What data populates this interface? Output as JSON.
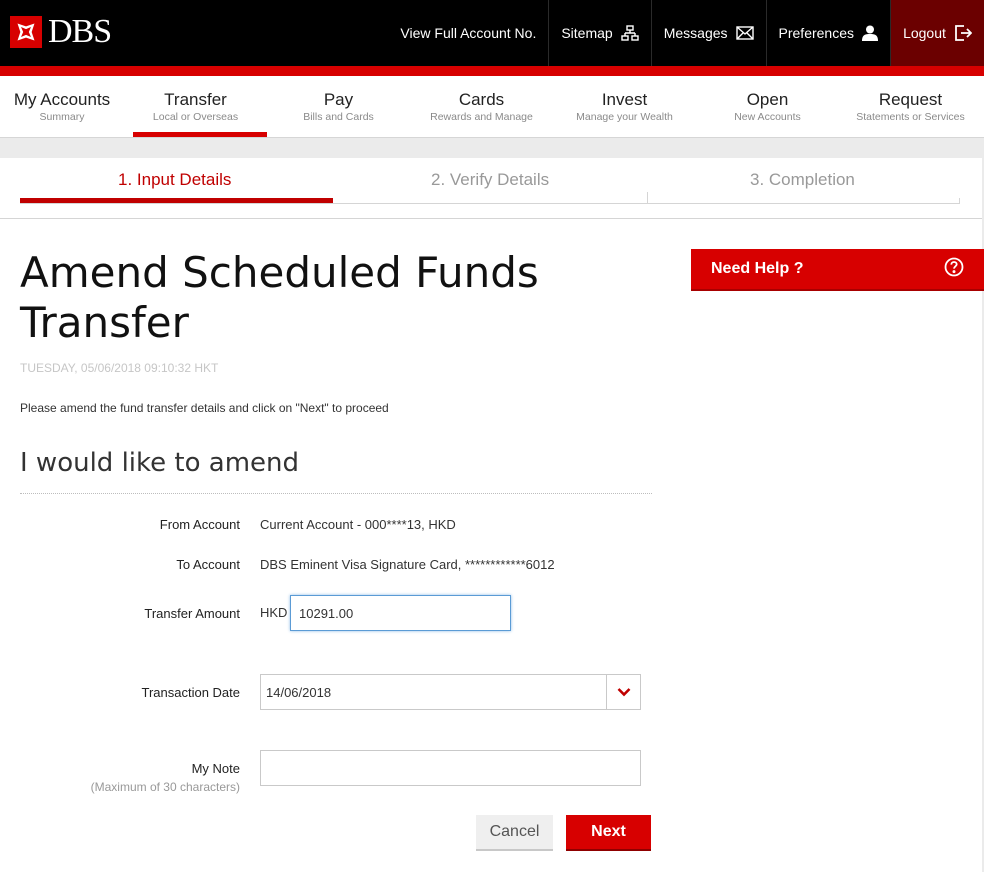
{
  "brand": {
    "name": "DBS",
    "accent": "#d70000",
    "dark": "#000000"
  },
  "top_links": [
    {
      "label": "View Full Account No.",
      "icon": ""
    },
    {
      "label": "Sitemap",
      "icon": "sitemap-icon"
    },
    {
      "label": "Messages",
      "icon": "envelope-icon"
    },
    {
      "label": "Preferences",
      "icon": "user-icon"
    },
    {
      "label": "Logout",
      "icon": "logout-icon"
    }
  ],
  "main_nav": [
    {
      "title": "My Accounts",
      "subtitle": "Summary"
    },
    {
      "title": "Transfer",
      "subtitle": "Local or Overseas",
      "active": true
    },
    {
      "title": "Pay",
      "subtitle": "Bills and Cards"
    },
    {
      "title": "Cards",
      "subtitle": "Rewards and Manage"
    },
    {
      "title": "Invest",
      "subtitle": "Manage your Wealth"
    },
    {
      "title": "Open",
      "subtitle": "New Accounts"
    },
    {
      "title": "Request",
      "subtitle": "Statements or Services"
    }
  ],
  "steps": [
    {
      "label": "1. Input Details",
      "state": "active"
    },
    {
      "label": "2. Verify Details",
      "state": "pending"
    },
    {
      "label": "3. Completion",
      "state": "pending"
    }
  ],
  "page": {
    "title": "Amend Scheduled Funds Transfer",
    "timestamp": "TUESDAY, 05/06/2018 09:10:32 HKT",
    "intro": "Please amend the fund transfer details and click on \"Next\" to proceed",
    "section_heading": "I would like to amend"
  },
  "form": {
    "from_account_label": "From Account",
    "from_account_value": "Current Account - 000****13, HKD",
    "to_account_label": "To Account",
    "to_account_value": "DBS Eminent Visa Signature Card, ************6012",
    "amount_label": "Transfer Amount",
    "amount_currency": "HKD",
    "amount_value": "10291.00",
    "date_label": "Transaction Date",
    "date_value": "14/06/2018",
    "note_label": "My Note",
    "note_hint": "(Maximum of 30 characters)",
    "note_value": ""
  },
  "actions": {
    "cancel_label": "Cancel",
    "next_label": "Next"
  },
  "help": {
    "label": "Need Help ?",
    "icon": "question-circle-icon"
  }
}
